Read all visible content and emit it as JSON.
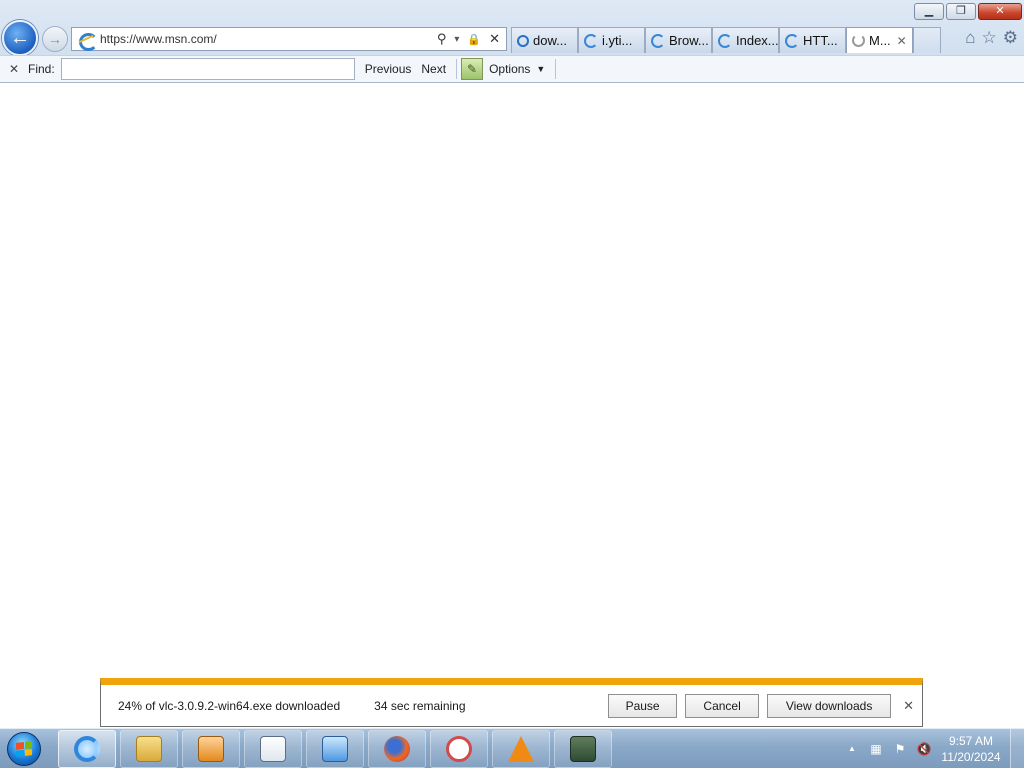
{
  "window": {
    "minimize": "▁",
    "restore": "❐",
    "close": "✕"
  },
  "nav": {
    "back": "←",
    "forward": "→"
  },
  "address": {
    "url": "https://www.msn.com/",
    "search_glyph": "⚲",
    "dropdown_glyph": "▾",
    "lock_glyph": "🔒",
    "stop_glyph": "✕"
  },
  "tabs": [
    {
      "label": "dow...",
      "icon": "search"
    },
    {
      "label": "i.yti...",
      "icon": "ie"
    },
    {
      "label": "Brow...",
      "icon": "ie"
    },
    {
      "label": "Index...",
      "icon": "ie"
    },
    {
      "label": "HTT...",
      "icon": "ie"
    },
    {
      "label": "M...",
      "icon": "loading",
      "active": true,
      "close": "✕"
    }
  ],
  "toolbar_icons": {
    "home": "⌂",
    "favorites": "☆",
    "settings": "⚙"
  },
  "find": {
    "close": "✕",
    "label": "Find:",
    "value": "",
    "previous": "Previous",
    "next": "Next",
    "options": "Options",
    "options_caret": "▼"
  },
  "download": {
    "status": "24% of vlc-3.0.9.2-win64.exe downloaded",
    "remaining": "34 sec remaining",
    "progress_percent": 24,
    "pause": "Pause",
    "cancel": "Cancel",
    "view": "View downloads",
    "close": "✕"
  },
  "taskbar": {
    "pins": [
      {
        "name": "ie",
        "active": true
      },
      {
        "name": "file-explorer"
      },
      {
        "name": "media-player"
      },
      {
        "name": "notepad-window"
      },
      {
        "name": "control-panel"
      },
      {
        "name": "firefox"
      },
      {
        "name": "snipping-tool"
      },
      {
        "name": "vlc"
      },
      {
        "name": "network-monitor"
      }
    ],
    "time": "9:57 AM",
    "date": "11/20/2024",
    "tray_up": "▲"
  }
}
